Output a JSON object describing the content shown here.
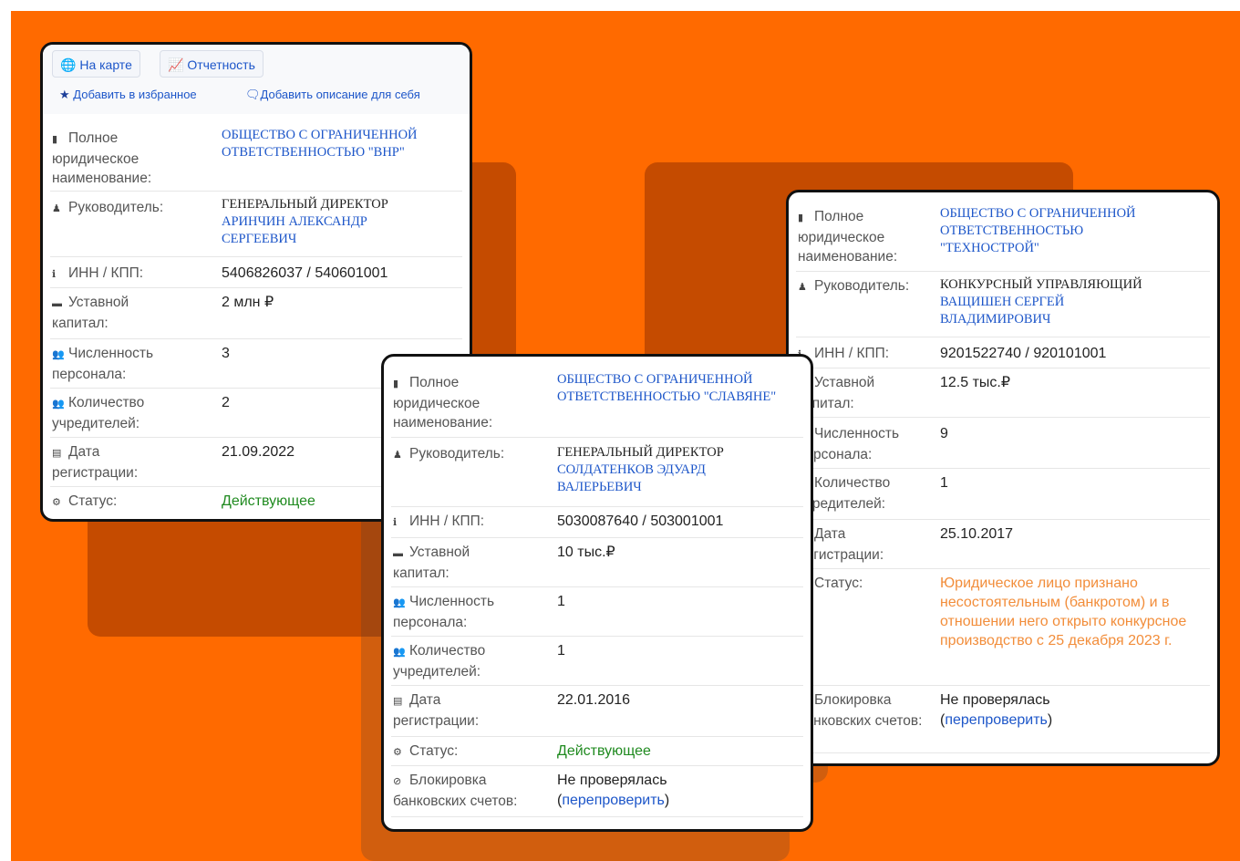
{
  "card1": {
    "map_button": "На карте",
    "reports_button": "Отчетность",
    "favorite_link": "Добавить в избранное",
    "description_link": "Добавить описание для себя",
    "fields": {
      "name_label": "Полное юридическое наименование:",
      "name_value": "ОБЩЕСТВО С ОГРАНИЧЕННОЙ ОТВЕТСТВЕННОСТЬЮ \"ВНР\"",
      "head_label": "Руководитель:",
      "head_title": "ГЕНЕРАЛЬНЫЙ ДИРЕКТОР",
      "head_name": "АРИНЧИН АЛЕКСАНДР СЕРГЕЕВИЧ",
      "inn_label": "ИНН / КПП:",
      "inn_value": "5406826037 / 540601001",
      "capital_label": "Уставной капитал:",
      "capital_value": "2 млн ₽",
      "staff_label": "Численность персонала:",
      "staff_value": "3",
      "founders_label": "Количество учредителей:",
      "founders_value": "2",
      "reg_label": "Дата регистрации:",
      "reg_value": "21.09.2022",
      "status_label": "Статус:",
      "status_value": "Действующее"
    }
  },
  "card2": {
    "fields": {
      "name_label": "Полное юридическое наименование:",
      "name_value": "ОБЩЕСТВО С ОГРАНИЧЕННОЙ ОТВЕТСТВЕННОСТЬЮ \"СЛАВЯНЕ\"",
      "head_label": "Руководитель:",
      "head_title": "ГЕНЕРАЛЬНЫЙ ДИРЕКТОР",
      "head_name": "СОЛДАТЕНКОВ ЭДУАРД ВАЛЕРЬЕВИЧ",
      "inn_label": "ИНН / КПП:",
      "inn_value": "5030087640 / 503001001",
      "capital_label": "Уставной капитал:",
      "capital_value": "10 тыс.₽",
      "staff_label": "Численность персонала:",
      "staff_value": "1",
      "founders_label": "Количество учредителей:",
      "founders_value": "1",
      "reg_label": "Дата регистрации:",
      "reg_value": "22.01.2016",
      "status_label": "Статус:",
      "status_value": "Действующее",
      "block_label": "Блокировка банковских счетов:",
      "block_value": "Не проверялась",
      "block_open": "(",
      "block_link": "перепроверить",
      "block_close": ")"
    }
  },
  "card3": {
    "fields": {
      "name_label": "Полное юридическое наименование:",
      "name_value": "ОБЩЕСТВО С ОГРАНИЧЕННОЙ ОТВЕТСТВЕННОСТЬЮ \"ТЕХНОСТРОЙ\"",
      "head_label": "Руководитель:",
      "head_title": "КОНКУРСНЫЙ УПРАВЛЯЮЩИЙ",
      "head_name": "ВАЩИШЕН СЕРГЕЙ ВЛАДИМИРОВИЧ",
      "inn_label": "ИНН / КПП:",
      "inn_value": "9201522740 / 920101001",
      "capital_label": "Уставной капитал:",
      "capital_value": "12.5 тыс.₽",
      "staff_label": "Численность персонала:",
      "staff_value": "9",
      "founders_label": "Количество учредителей:",
      "founders_value": "1",
      "reg_label": "Дата регистрации:",
      "reg_value": "25.10.2017",
      "status_label": "Статус:",
      "status_value": "Юридическое лицо признано несостоятельным (банкротом) и в отношении него открыто конкурсное производство с 25 декабря 2023 г.",
      "block_label": "Блокировка банковских счетов:",
      "block_value": "Не проверялась",
      "block_open": "(",
      "block_link": "перепроверить",
      "block_close": ")"
    }
  },
  "colors": {
    "background": "#ff6a00",
    "link": "#1d56c9",
    "active_status": "#1f8a1f",
    "bankrupt_status": "#f28d3a"
  }
}
